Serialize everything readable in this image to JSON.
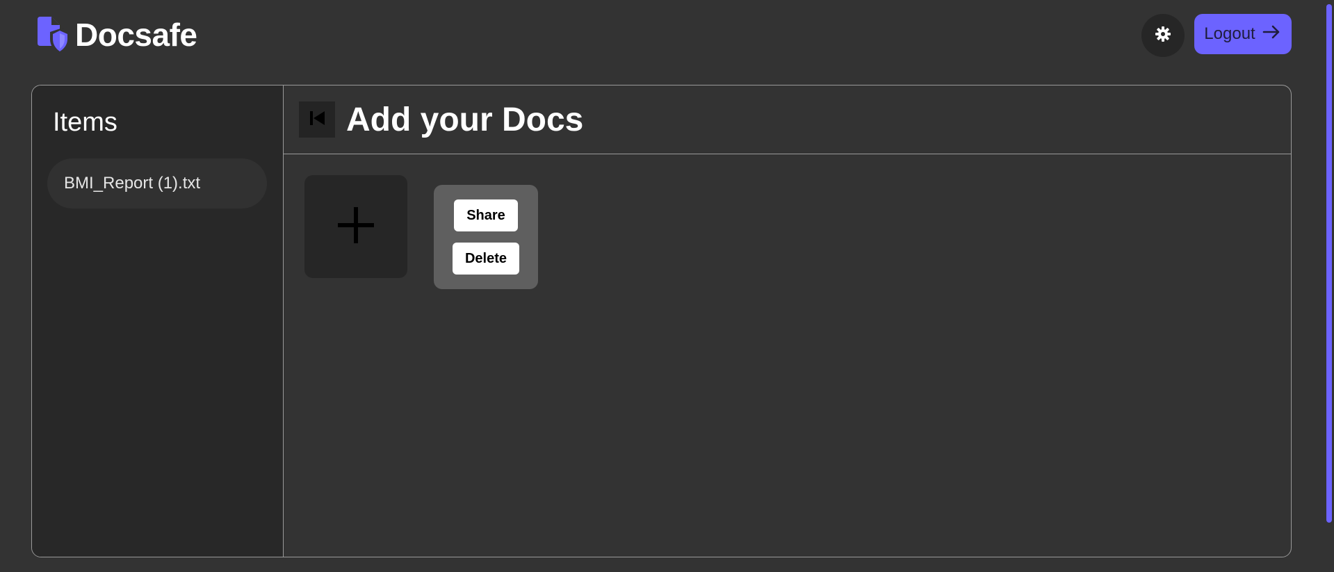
{
  "app": {
    "brand_name": "Docsafe",
    "accent_color": "#6c63ff",
    "logo_icon": "document-shield-icon"
  },
  "header": {
    "settings_icon": "gear-icon",
    "logout_label": "Logout",
    "logout_icon": "arrow-right-icon"
  },
  "sidebar": {
    "title": "Items",
    "items": [
      {
        "label": "BMI_Report (1).txt"
      }
    ]
  },
  "main": {
    "back_icon": "skip-back-icon",
    "title": "Add your Docs",
    "add_icon": "plus-icon",
    "doc_tile": {
      "share_label": "Share",
      "delete_label": "Delete"
    }
  }
}
